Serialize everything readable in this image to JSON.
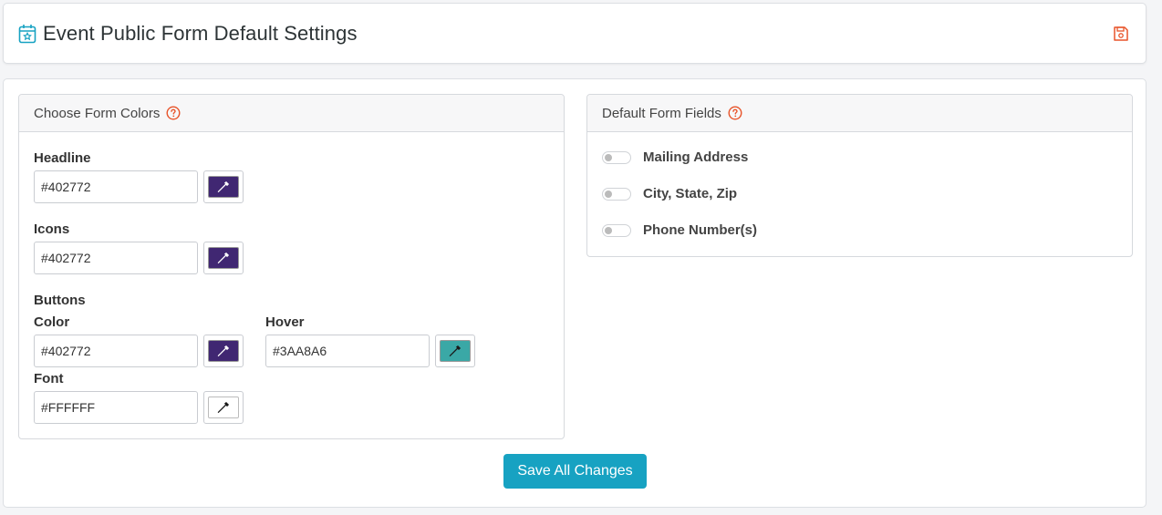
{
  "header": {
    "title": "Event Public Form Default Settings",
    "title_icon": "calendar-star-icon",
    "save_icon": "floppy-disk-icon"
  },
  "colors_panel": {
    "title": "Choose Form Colors",
    "help_icon": "question-circle-icon",
    "headline": {
      "label": "Headline",
      "value": "#402772",
      "swatch": "#402772"
    },
    "icons": {
      "label": "Icons",
      "value": "#402772",
      "swatch": "#402772"
    },
    "buttons_label": "Buttons",
    "button_color": {
      "label": "Color",
      "value": "#402772",
      "swatch": "#402772"
    },
    "button_hover": {
      "label": "Hover",
      "value": "#3AA8A6",
      "swatch": "#3AA8A6"
    },
    "button_font": {
      "label": "Font",
      "value": "#FFFFFF",
      "swatch": "#FFFFFF"
    }
  },
  "fields_panel": {
    "title": "Default Form Fields",
    "help_icon": "question-circle-icon",
    "fields": [
      {
        "label": "Mailing Address",
        "enabled": false
      },
      {
        "label": "City, State, Zip",
        "enabled": false
      },
      {
        "label": "Phone Number(s)",
        "enabled": false
      }
    ]
  },
  "save_all_label": "Save All Changes",
  "colors": {
    "accent": "#17a2c2",
    "help": "#e8542a",
    "save_icon": "#e8542a",
    "title_icon": "#17a2c2"
  }
}
